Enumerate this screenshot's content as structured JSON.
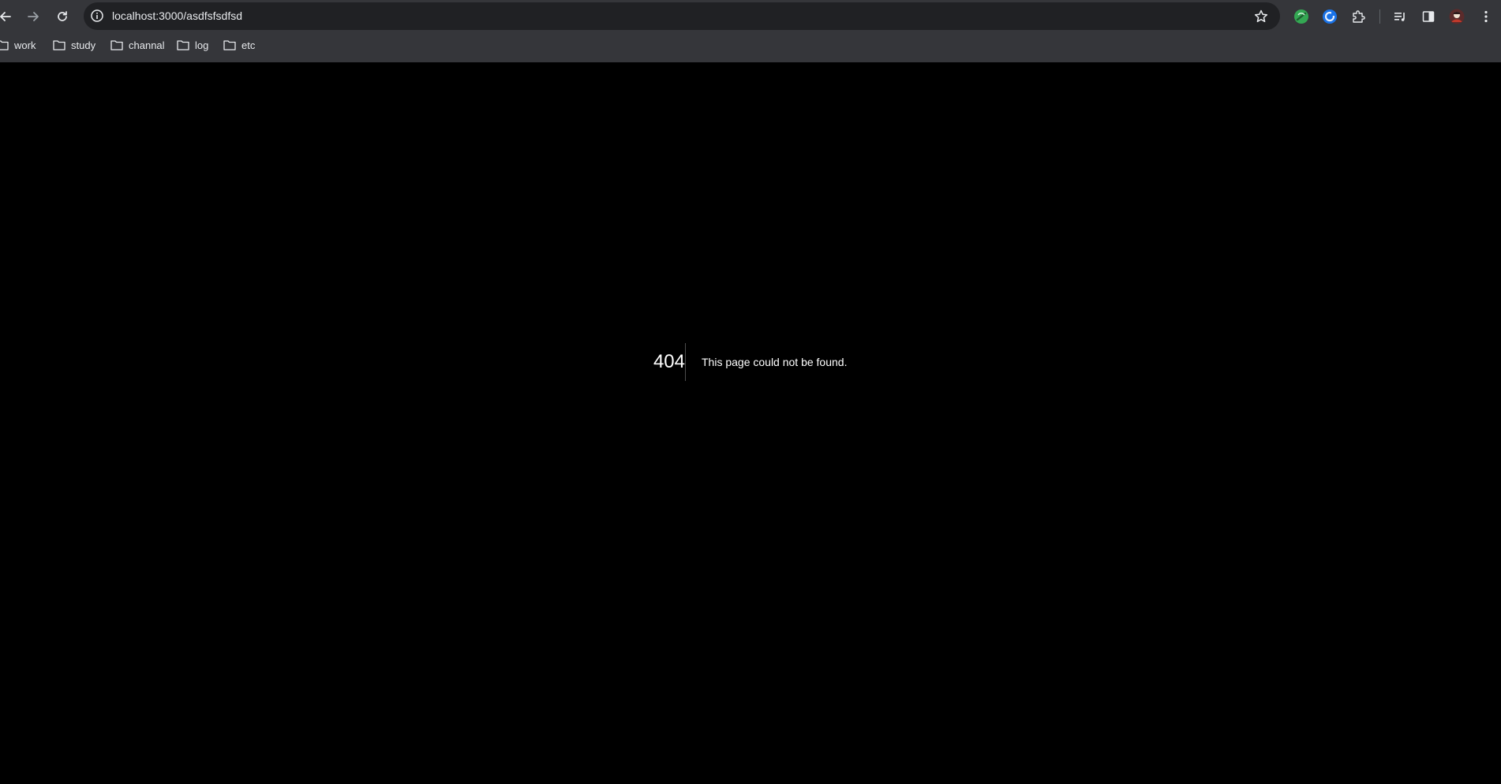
{
  "browser": {
    "url": "localhost:3000/asdfsfsdfsd",
    "icons": {
      "back": "arrow-left-icon",
      "forward": "arrow-right-icon",
      "reload": "reload-icon",
      "site_info": "info-icon",
      "bookmark_star": "star-icon",
      "extension_1": "green-extension-icon",
      "extension_2": "blue-extension-icon",
      "extensions_menu": "puzzle-icon",
      "media": "media-queue-icon",
      "side_panel": "side-panel-icon",
      "profile": "avatar-icon",
      "menu": "kebab-menu-icon"
    }
  },
  "bookmarks": [
    {
      "label": "work"
    },
    {
      "label": "study"
    },
    {
      "label": "channal"
    },
    {
      "label": "log"
    },
    {
      "label": "etc"
    }
  ],
  "not_found": {
    "code": "404",
    "message": "This page could not be found."
  },
  "colors": {
    "chrome_bg": "#35363a",
    "omnibox_bg": "#202124",
    "page_bg": "#000000",
    "text": "#ffffff"
  }
}
